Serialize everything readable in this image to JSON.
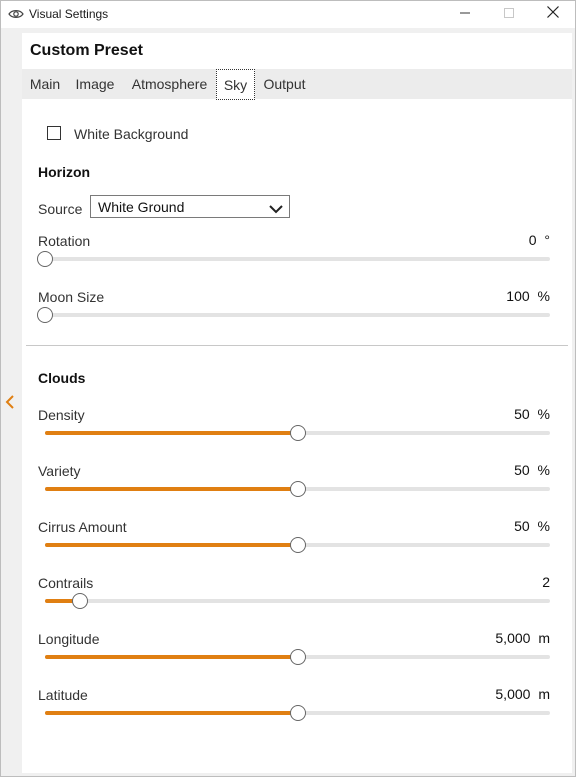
{
  "window": {
    "title": "Visual Settings",
    "icons": {
      "app": "eye-icon",
      "minimize": "minimize-icon",
      "maximize": "maximize-icon",
      "close": "close-icon"
    }
  },
  "sidebar": {
    "collapse_icon": "chevron-left-icon",
    "accent": "#e07f12"
  },
  "panel": {
    "title": "Custom Preset",
    "tabs": [
      {
        "label": "Main",
        "active": false
      },
      {
        "label": "Image",
        "active": false
      },
      {
        "label": "Atmosphere",
        "active": false
      },
      {
        "label": "Sky",
        "active": true
      },
      {
        "label": "Output",
        "active": false
      }
    ]
  },
  "sky": {
    "white_background": {
      "label": "White Background",
      "checked": false
    },
    "horizon": {
      "heading": "Horizon",
      "source": {
        "label": "Source",
        "value": "White Ground"
      },
      "rotation": {
        "label": "Rotation",
        "value": "0",
        "unit": "°",
        "level": 0
      },
      "moon_size": {
        "label": "Moon Size",
        "value": "100",
        "unit": "%",
        "level": 0
      }
    },
    "clouds": {
      "heading": "Clouds",
      "density": {
        "label": "Density",
        "value": "50",
        "unit": "%",
        "level": 0.5
      },
      "variety": {
        "label": "Variety",
        "value": "50",
        "unit": "%",
        "level": 0.5
      },
      "cirrus_amount": {
        "label": "Cirrus Amount",
        "value": "50",
        "unit": "%",
        "level": 0.5
      },
      "contrails": {
        "label": "Contrails",
        "value": "2",
        "unit": "",
        "level": 0.07
      },
      "longitude": {
        "label": "Longitude",
        "value": "5,000",
        "unit": "m",
        "level": 0.5
      },
      "latitude": {
        "label": "Latitude",
        "value": "5,000",
        "unit": "m",
        "level": 0.5
      }
    }
  },
  "colors": {
    "accent": "#e07f12",
    "track": "#e3e3e3",
    "thumb_border": "#666666"
  }
}
